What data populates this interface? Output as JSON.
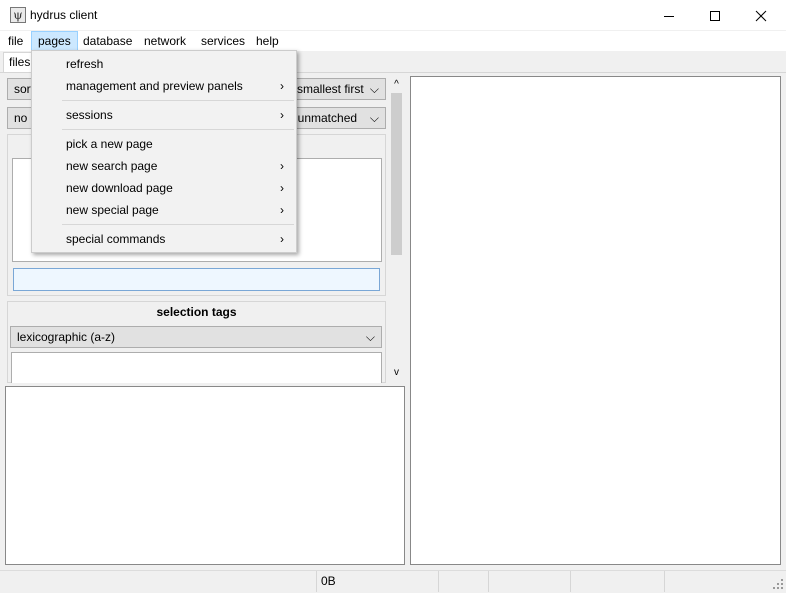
{
  "window": {
    "title": "hydrus client",
    "icon_glyph": "ψ"
  },
  "menubar": {
    "items": [
      "file",
      "pages",
      "database",
      "network",
      "services",
      "help"
    ],
    "active": "pages"
  },
  "tabs": {
    "files": "files"
  },
  "left_panel": {
    "sort_combo": "sort",
    "sort_order_combo": "smallest first",
    "collect_combo": "no",
    "collect_match_combo": "t unmatched",
    "search_input_value": "",
    "selection_tags_title": "selection tags",
    "tag_sort_combo": "lexicographic (a-z)"
  },
  "pages_menu": {
    "items": [
      {
        "label": "refresh",
        "submenu": false
      },
      {
        "label": "management and preview panels",
        "submenu": true
      },
      {
        "label": "sessions",
        "submenu": true
      },
      {
        "label": "pick a new page",
        "submenu": false
      },
      {
        "label": "new search page",
        "submenu": true
      },
      {
        "label": "new download page",
        "submenu": true
      },
      {
        "label": "new special page",
        "submenu": true
      },
      {
        "label": "special commands",
        "submenu": true
      }
    ],
    "submenu_glyph": "›"
  },
  "statusbar": {
    "cells": [
      "",
      "0B",
      "",
      "",
      "",
      ""
    ]
  },
  "colors": {
    "menu_highlight": "#cce8ff",
    "search_input_bg": "#eef7ff"
  }
}
